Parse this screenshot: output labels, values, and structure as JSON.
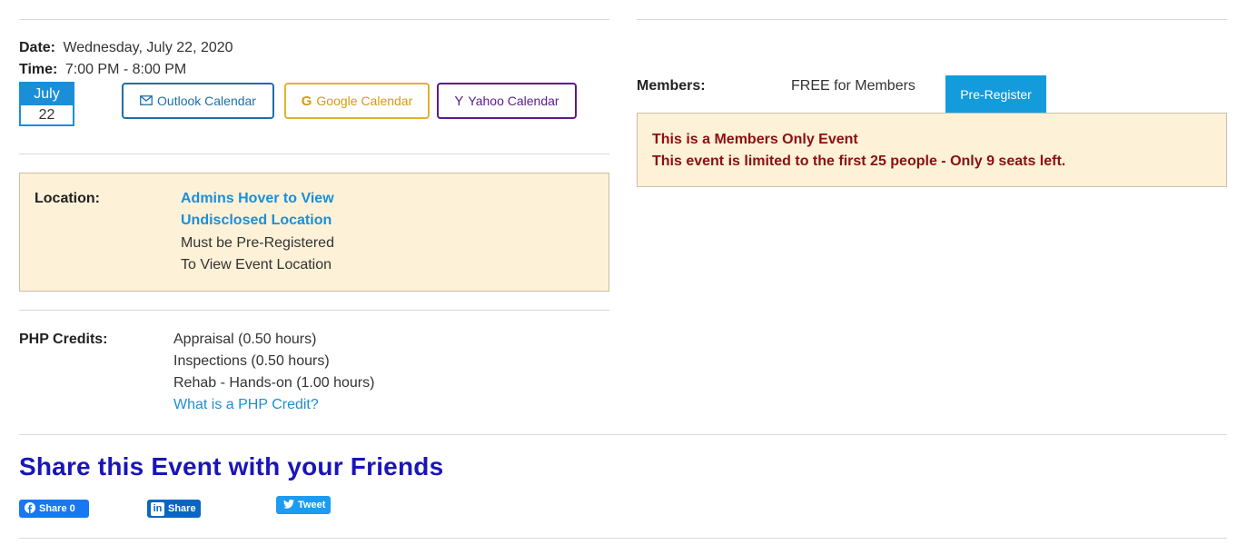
{
  "event": {
    "date_label": "Date:",
    "date_value": "Wednesday, July 22, 2020",
    "time_label": "Time:",
    "time_value": "7:00 PM - 8:00 PM",
    "calendar_badge": {
      "month": "July",
      "day": "22"
    }
  },
  "calendar_buttons": {
    "outlook": {
      "label": "Outlook Calendar",
      "icon": "envelope-icon"
    },
    "google": {
      "label": "Google Calendar",
      "icon": "google-g-icon"
    },
    "yahoo": {
      "label": "Yahoo Calendar",
      "icon": "yahoo-y-icon"
    }
  },
  "location": {
    "label": "Location:",
    "link_line1": "Admins Hover to View",
    "link_line2": "Undisclosed Location",
    "note_line1": "Must be Pre-Registered",
    "note_line2": "To View Event Location"
  },
  "php_credits": {
    "label": "PHP Credits:",
    "items": [
      "Appraisal (0.50 hours)",
      "Inspections (0.50 hours)",
      "Rehab - Hands-on (1.00 hours)"
    ],
    "help_link": "What is a PHP Credit?"
  },
  "members": {
    "label": "Members:",
    "price": "FREE for Members",
    "button": "Pre-Register",
    "notice_line1": "This is a Members Only Event",
    "notice_line2": "This event is limited to the first 25 people - Only 9 seats left."
  },
  "share": {
    "title": "Share this Event with your Friends",
    "facebook": "Share 0",
    "linkedin": "Share",
    "twitter": "Tweet"
  },
  "colors": {
    "accent_blue": "#149bdc",
    "share_title": "#1a15b8",
    "notice_bg": "#fdf1d8",
    "notice_text": "#8b1010"
  }
}
